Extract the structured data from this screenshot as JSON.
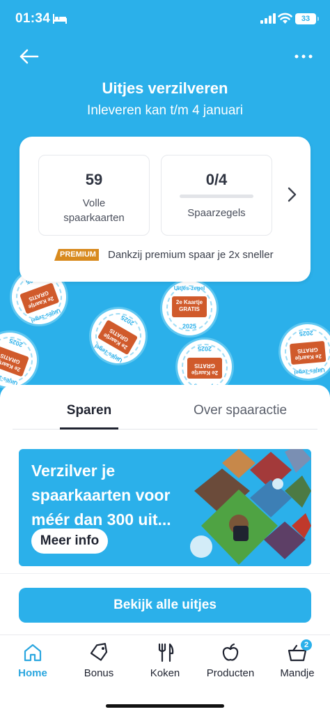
{
  "status_bar": {
    "time": "01:34",
    "battery": "33"
  },
  "header": {
    "title": "Uitjes verzilveren",
    "subtitle": "Inleveren kan t/m 4 januari"
  },
  "summary": {
    "cards": [
      {
        "value": "59",
        "label_line1": "Volle",
        "label_line2": "spaarkaarten"
      },
      {
        "value": "0/4",
        "label": "Spaarzegels",
        "progress": 0.0
      }
    ],
    "premium_badge": "PREMIUM",
    "premium_text": "Dankzij premium spaar je 2x sneller"
  },
  "stamps": {
    "ring_text": "Uitjes-zegel",
    "ticket_line1": "2e Kaartje",
    "ticket_line2": "GRATIS",
    "year": "2025"
  },
  "tabs": [
    {
      "label": "Sparen",
      "active": true
    },
    {
      "label": "Over spaaractie",
      "active": false
    }
  ],
  "promo": {
    "line1": "Verzilver je",
    "line2": "spaarkaarten voor",
    "line3": "méér dan 300 uit...",
    "button": "Meer info"
  },
  "cta": {
    "label": "Bekijk alle uitjes"
  },
  "bottom_nav": [
    {
      "label": "Home",
      "icon": "home-icon",
      "active": true
    },
    {
      "label": "Bonus",
      "icon": "tag-icon",
      "active": false
    },
    {
      "label": "Koken",
      "icon": "cutlery-icon",
      "active": false
    },
    {
      "label": "Producten",
      "icon": "apple-icon",
      "active": false
    },
    {
      "label": "Mandje",
      "icon": "basket-icon",
      "active": false,
      "badge": "2"
    }
  ],
  "colors": {
    "brand": "#2bb0ea",
    "premium": "#d88a1e",
    "ticket": "#d05a2b"
  }
}
